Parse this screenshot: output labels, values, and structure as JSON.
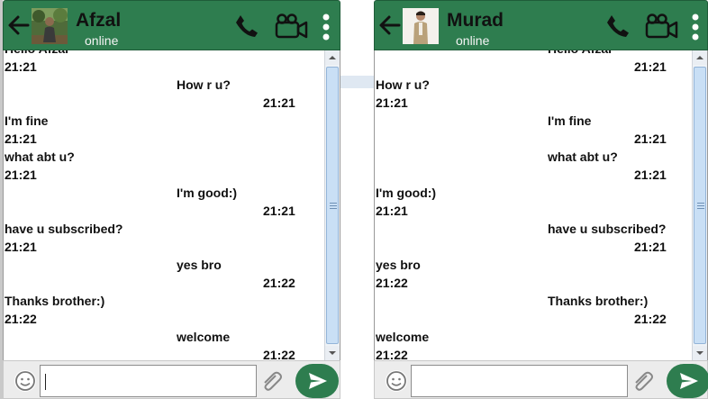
{
  "colors": {
    "header": "#2e7d4f",
    "send": "#2e7d4f"
  },
  "left_window": {
    "contact_name": "Afzal",
    "status": "online",
    "messages": [
      {
        "id": "l0",
        "side": "recv",
        "text": "Hello Afzal",
        "time": "21:21"
      },
      {
        "id": "l1",
        "side": "sent",
        "text": "How r u?",
        "time": "21:21"
      },
      {
        "id": "l2",
        "side": "recv",
        "text": "I'm fine",
        "time": "21:21"
      },
      {
        "id": "l3",
        "side": "recv",
        "text": "what abt u?",
        "time": "21:21"
      },
      {
        "id": "l4",
        "side": "sent",
        "text": "I'm good:)",
        "time": "21:21"
      },
      {
        "id": "l5",
        "side": "recv",
        "text": "have u subscribed?",
        "time": "21:21"
      },
      {
        "id": "l6",
        "side": "sent",
        "text": "yes bro",
        "time": "21:22"
      },
      {
        "id": "l7",
        "side": "recv",
        "text": "Thanks brother:)",
        "time": "21:22"
      },
      {
        "id": "l8",
        "side": "sent",
        "text": "welcome",
        "time": "21:22"
      }
    ],
    "input_value": ""
  },
  "right_window": {
    "contact_name": "Murad",
    "status": "online",
    "messages": [
      {
        "id": "r0",
        "side": "sent",
        "text": "Hello Afzal",
        "time": "21:21"
      },
      {
        "id": "r1",
        "side": "recv",
        "text": "How r u?",
        "time": "21:21"
      },
      {
        "id": "r2",
        "side": "sent",
        "text": "I'm fine",
        "time": "21:21"
      },
      {
        "id": "r3",
        "side": "sent",
        "text": "what abt u?",
        "time": "21:21"
      },
      {
        "id": "r4",
        "side": "recv",
        "text": "I'm good:)",
        "time": "21:21"
      },
      {
        "id": "r5",
        "side": "sent",
        "text": "have u subscribed?",
        "time": "21:21"
      },
      {
        "id": "r6",
        "side": "recv",
        "text": "yes bro",
        "time": "21:22"
      },
      {
        "id": "r7",
        "side": "sent",
        "text": "Thanks brother:)",
        "time": "21:22"
      },
      {
        "id": "r8",
        "side": "recv",
        "text": "welcome",
        "time": "21:22"
      }
    ],
    "input_value": ""
  },
  "icons": [
    "back-arrow-icon",
    "phone-icon",
    "video-camera-icon",
    "more-vertical-icon",
    "emoji-icon",
    "paperclip-icon",
    "send-icon"
  ]
}
